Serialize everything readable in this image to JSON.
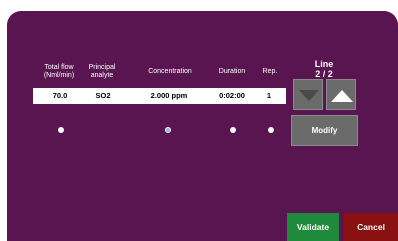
{
  "table": {
    "headers": {
      "total_flow_line1": "Total flow",
      "total_flow_line2": "(Nml/min)",
      "analyte_line1": "Principal",
      "analyte_line2": "analyte",
      "concentration": "Concentration",
      "duration": "Duration",
      "rep": "Rep."
    },
    "row": {
      "total_flow": "70.0",
      "analyte": "SO2",
      "concentration": "2.000 ppm",
      "duration": "0:02:00",
      "rep": "1"
    }
  },
  "line": {
    "title": "Line",
    "counter": "2 / 2"
  },
  "buttons": {
    "modify": "Modify",
    "validate": "Validate",
    "cancel": "Cancel"
  },
  "icons": {
    "down": "arrow-down-icon",
    "up": "arrow-up-icon"
  },
  "selected_radio": "concentration",
  "colors": {
    "panel": "#58154f",
    "validate": "#1f8a3b",
    "cancel": "#8a1111",
    "button_grey": "#6b6b6b"
  }
}
